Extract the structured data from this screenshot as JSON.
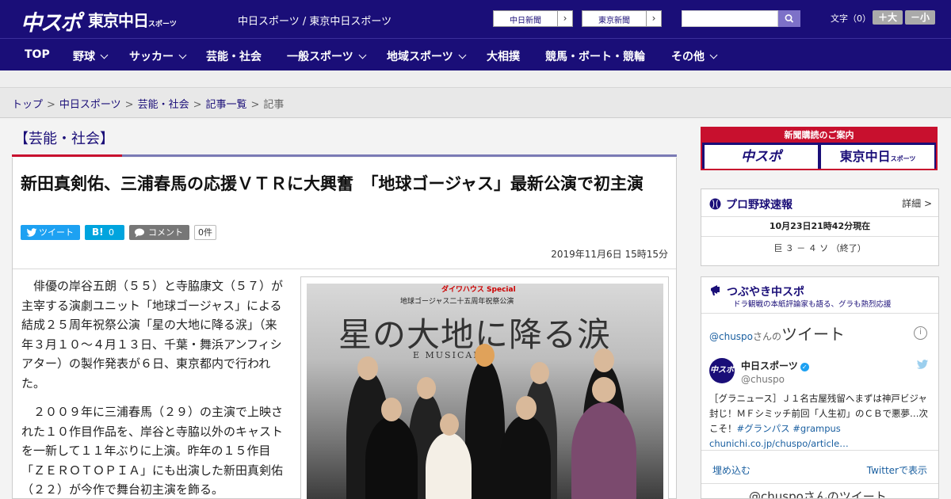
{
  "header": {
    "logo_chuspo": "中スポ",
    "logo_tokyo": "東京中日",
    "logo_tokyo_small": "スポーツ",
    "site_names": "中日スポーツ / 東京中日スポーツ",
    "paper_links": [
      {
        "label": "中日新聞",
        "chevron": "›"
      },
      {
        "label": "東京新聞",
        "chevron": "›"
      }
    ],
    "search_placeholder": "",
    "font_size_label": "文字（0）",
    "font_plus": "＋大",
    "font_minus": "－小"
  },
  "nav": [
    {
      "label": "TOP",
      "dropdown": false
    },
    {
      "label": "野球",
      "dropdown": true
    },
    {
      "label": "サッカー",
      "dropdown": true
    },
    {
      "label": "芸能・社会",
      "dropdown": false
    },
    {
      "label": "一般スポーツ",
      "dropdown": true
    },
    {
      "label": "地域スポーツ",
      "dropdown": true
    },
    {
      "label": "大相撲",
      "dropdown": false
    },
    {
      "label": "競馬・ボート・競輪",
      "dropdown": false
    },
    {
      "label": "その他",
      "dropdown": true
    }
  ],
  "breadcrumb": {
    "items": [
      "トップ",
      "中日スポーツ",
      "芸能・社会",
      "記事一覧"
    ],
    "current": "記事",
    "sep": ">"
  },
  "article": {
    "section": "【芸能・社会】",
    "headline": "新田真剣佑、三浦春馬の応援ＶＴＲに大興奮　「地球ゴージャス」最新公演で初主演",
    "share": {
      "tweet": "ツイート",
      "hatena": "B!",
      "hatena_count": "0",
      "comment": "コメント",
      "comment_count": "0件"
    },
    "date": "2019年11月6日 15時15分",
    "paragraphs": [
      "俳優の岸谷五朗（５５）と寺脇康文（５７）が主宰する演劇ユニット「地球ゴージャス」による結成２５周年祝祭公演「星の大地に降る涙」（来年３月１０～４月１３日、千葉・舞浜アンフィシアター）の製作発表が６日、東京都内で行われた。",
      "２００９年に三浦春馬（２９）の主演で上映された１０作目作品を、岸谷と寺脇以外のキャストを一新して１１年ぶりに上演。昨年の１５作目「ＺＥＲＯＴＯＰＩＡ」にも出演した新田真剣佑（２２）が今作で舞台初主演を飾る。"
    ],
    "photo": {
      "sponsor": "ダイワハウス Special",
      "subtitle": "地球ゴージャス二十五周年祝祭公演",
      "title": "星の大地に降る涙",
      "musical": "E MUSICAL"
    }
  },
  "sidebar": {
    "ad": {
      "top": "新聞購読のご案内",
      "logo1": "中スポ",
      "logo2": "東京中日",
      "logo2_small": "スポーツ"
    },
    "baseball": {
      "title": "プロ野球速報",
      "detail": "詳細 >",
      "date": "10月23日21時42分現在",
      "score": "巨 ３ － ４ ソ （終了）"
    },
    "tweets": {
      "title": "つぶやき中スポ",
      "subtitle": "ドラ観戦の本紙評論家も語る、グラも熱烈応援",
      "handle": "@chuspo",
      "handle_suffix": "さんの",
      "heading": "ツイート",
      "info": "i",
      "avatar": "中スポ",
      "name": "中日スポーツ",
      "user": "@chuspo",
      "text": "［グラニュース］Ｊ１名古屋残留へまずは神戸ビジャ封じ！ＭＦシミッチ前回「人生初」のＣＢで悪夢…次こそ！",
      "tags": "#グランパス #grampus",
      "link": "chunichi.co.jp/chuspo/article…",
      "embed": "埋め込む",
      "view_on_twitter": "Twitterで表示",
      "next": "@chuspoさんのツイート"
    }
  }
}
